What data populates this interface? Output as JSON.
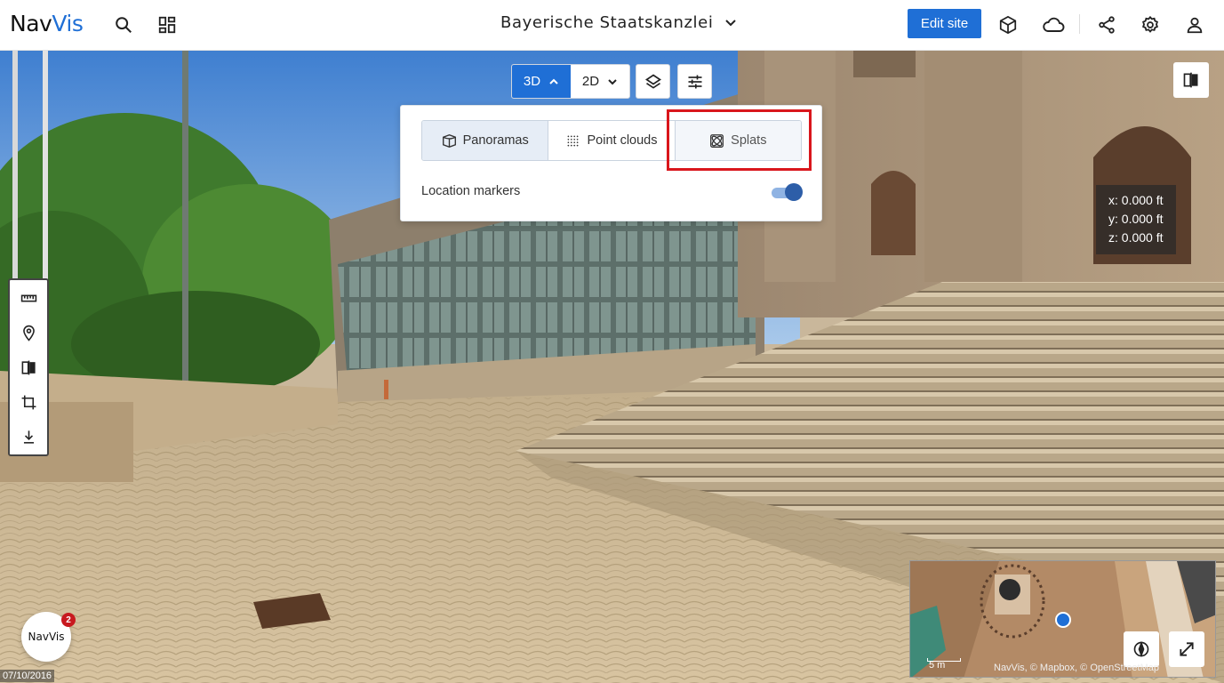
{
  "header": {
    "logo_main": "Nav",
    "logo_accent": "Vis",
    "site_title": "Bayerische Staatskanzlei",
    "edit_label": "Edit site",
    "icons": [
      "search-icon",
      "dashboard-icon",
      "cube-icon",
      "cloud-icon",
      "share-icon",
      "settings-icon",
      "user-icon"
    ]
  },
  "view_modes": {
    "mode_3d": "3D",
    "mode_2d": "2D",
    "active": "3D"
  },
  "layers_popover": {
    "options": [
      {
        "label": "Panoramas",
        "icon": "panorama-icon",
        "state": "active"
      },
      {
        "label": "Point clouds",
        "icon": "point-cloud-icon",
        "state": "inactive"
      },
      {
        "label": "Splats",
        "icon": "splats-icon",
        "state": "highlighted"
      }
    ],
    "location_markers_label": "Location markers",
    "location_markers_on": true
  },
  "coordinates": {
    "x": "x: 0.000 ft",
    "y": "y: 0.000 ft",
    "z": "z: 0.000 ft"
  },
  "left_toolbar": {
    "tools": [
      "ruler-icon",
      "location-pin-icon",
      "compare-icon",
      "crop-icon",
      "download-icon"
    ]
  },
  "minimap": {
    "scale_label": "5 m",
    "attribution": "NavVis, © Mapbox, © OpenStreetMap"
  },
  "chat": {
    "label": "NavVis",
    "badge_count": "2"
  },
  "capture_date": "07/10/2016",
  "colors": {
    "accent": "#1f6fd6",
    "highlight": "#d9161c",
    "badge": "#c8191f"
  }
}
